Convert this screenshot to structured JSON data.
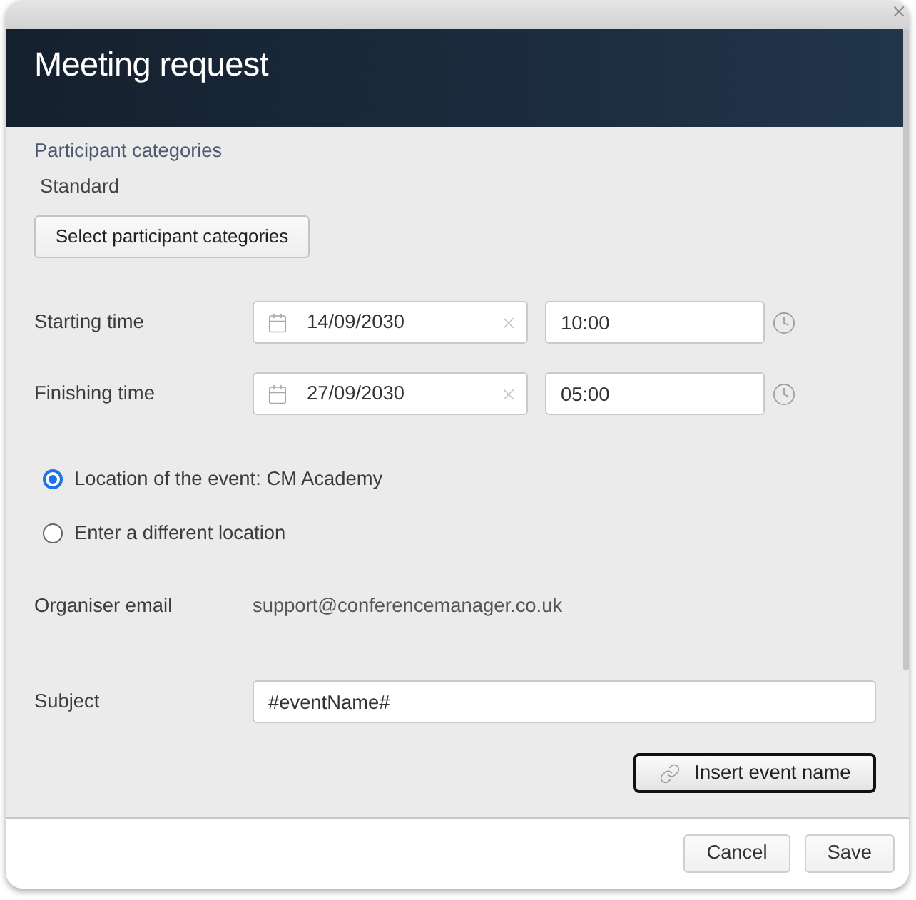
{
  "dialog": {
    "title": "Meeting request"
  },
  "participant_categories": {
    "label": "Participant categories",
    "value": "Standard",
    "button": "Select participant categories"
  },
  "time_rows": [
    {
      "label": "Starting time",
      "date": "14/09/2030",
      "time": "10:00"
    },
    {
      "label": "Finishing time",
      "date": "27/09/2030",
      "time": "05:00"
    }
  ],
  "location_options": [
    {
      "label": "Location of the event: CM Academy",
      "selected": true
    },
    {
      "label": "Enter a different location",
      "selected": false
    }
  ],
  "organiser_email": {
    "label": "Organiser email",
    "value": "support@conferencemanager.co.uk"
  },
  "subject": {
    "label": "Subject",
    "value": "#eventName#"
  },
  "insert_button": {
    "label": "Insert event name",
    "focused": true
  },
  "footer_buttons": [
    "Cancel",
    "Save"
  ]
}
